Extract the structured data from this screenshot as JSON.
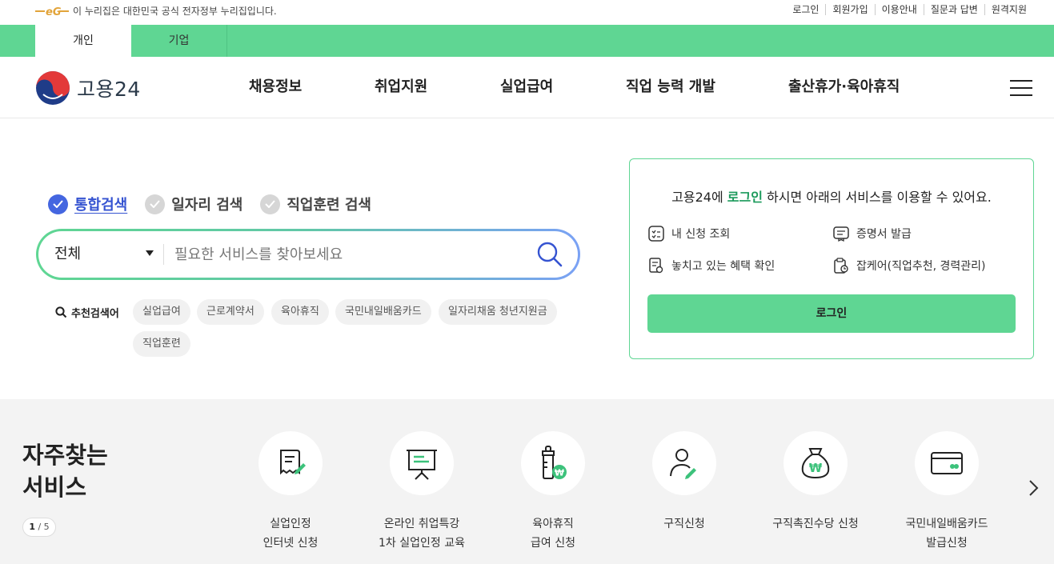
{
  "gov_banner": {
    "text": "이 누리집은 대한민국 공식 전자정부 누리집입니다.",
    "links": [
      "로그인",
      "회원가입",
      "이용안내",
      "질문과 답변",
      "원격지원"
    ]
  },
  "user_tabs": [
    "개인",
    "기업"
  ],
  "header": {
    "brand": "고용24",
    "nav": [
      "채용정보",
      "취업지원",
      "실업급여",
      "직업 능력 개발",
      "출산휴가·육아휴직"
    ]
  },
  "search": {
    "tabs": [
      "통합검색",
      "일자리 검색",
      "직업훈련 검색"
    ],
    "scope": "전체",
    "placeholder": "필요한 서비스를 찾아보세요",
    "recommend_label": "추천검색어",
    "keywords": [
      "실업급여",
      "근로계약서",
      "육아휴직",
      "국민내일배움카드",
      "일자리채움 청년지원금",
      "직업훈련"
    ]
  },
  "login_card": {
    "title_prefix": "고용24에 ",
    "title_highlight": "로그인",
    "title_suffix": " 하시면 아래의 서비스를 이용할 수 있어요.",
    "items": [
      "내 신청 조회",
      "증명서 발급",
      "놓치고 있는 혜택 확인",
      "잡케어(직업추천, 경력관리)"
    ],
    "button": "로그인"
  },
  "frequent": {
    "title_line1": "자주찾는",
    "title_line2": "서비스",
    "page_current": "1",
    "page_sep": " / ",
    "page_total": "5",
    "services": [
      {
        "label": "실업인정\n인터넷 신청",
        "icon": "document-pen-icon"
      },
      {
        "label": "온라인 취업특강\n1차 실업인정 교육",
        "icon": "presentation-board-icon"
      },
      {
        "label": "육아휴직\n급여 신청",
        "icon": "baby-bottle-won-icon"
      },
      {
        "label": "구직신청",
        "icon": "person-pen-icon"
      },
      {
        "label": "구직촉진수당 신청",
        "icon": "money-bag-won-icon"
      },
      {
        "label": "국민내일배움카드\n발급신청",
        "icon": "card-icon"
      }
    ]
  },
  "colors": {
    "brand_green": "#5fd693",
    "highlight_green": "#1b9a5b",
    "active_blue": "#4466e0"
  }
}
